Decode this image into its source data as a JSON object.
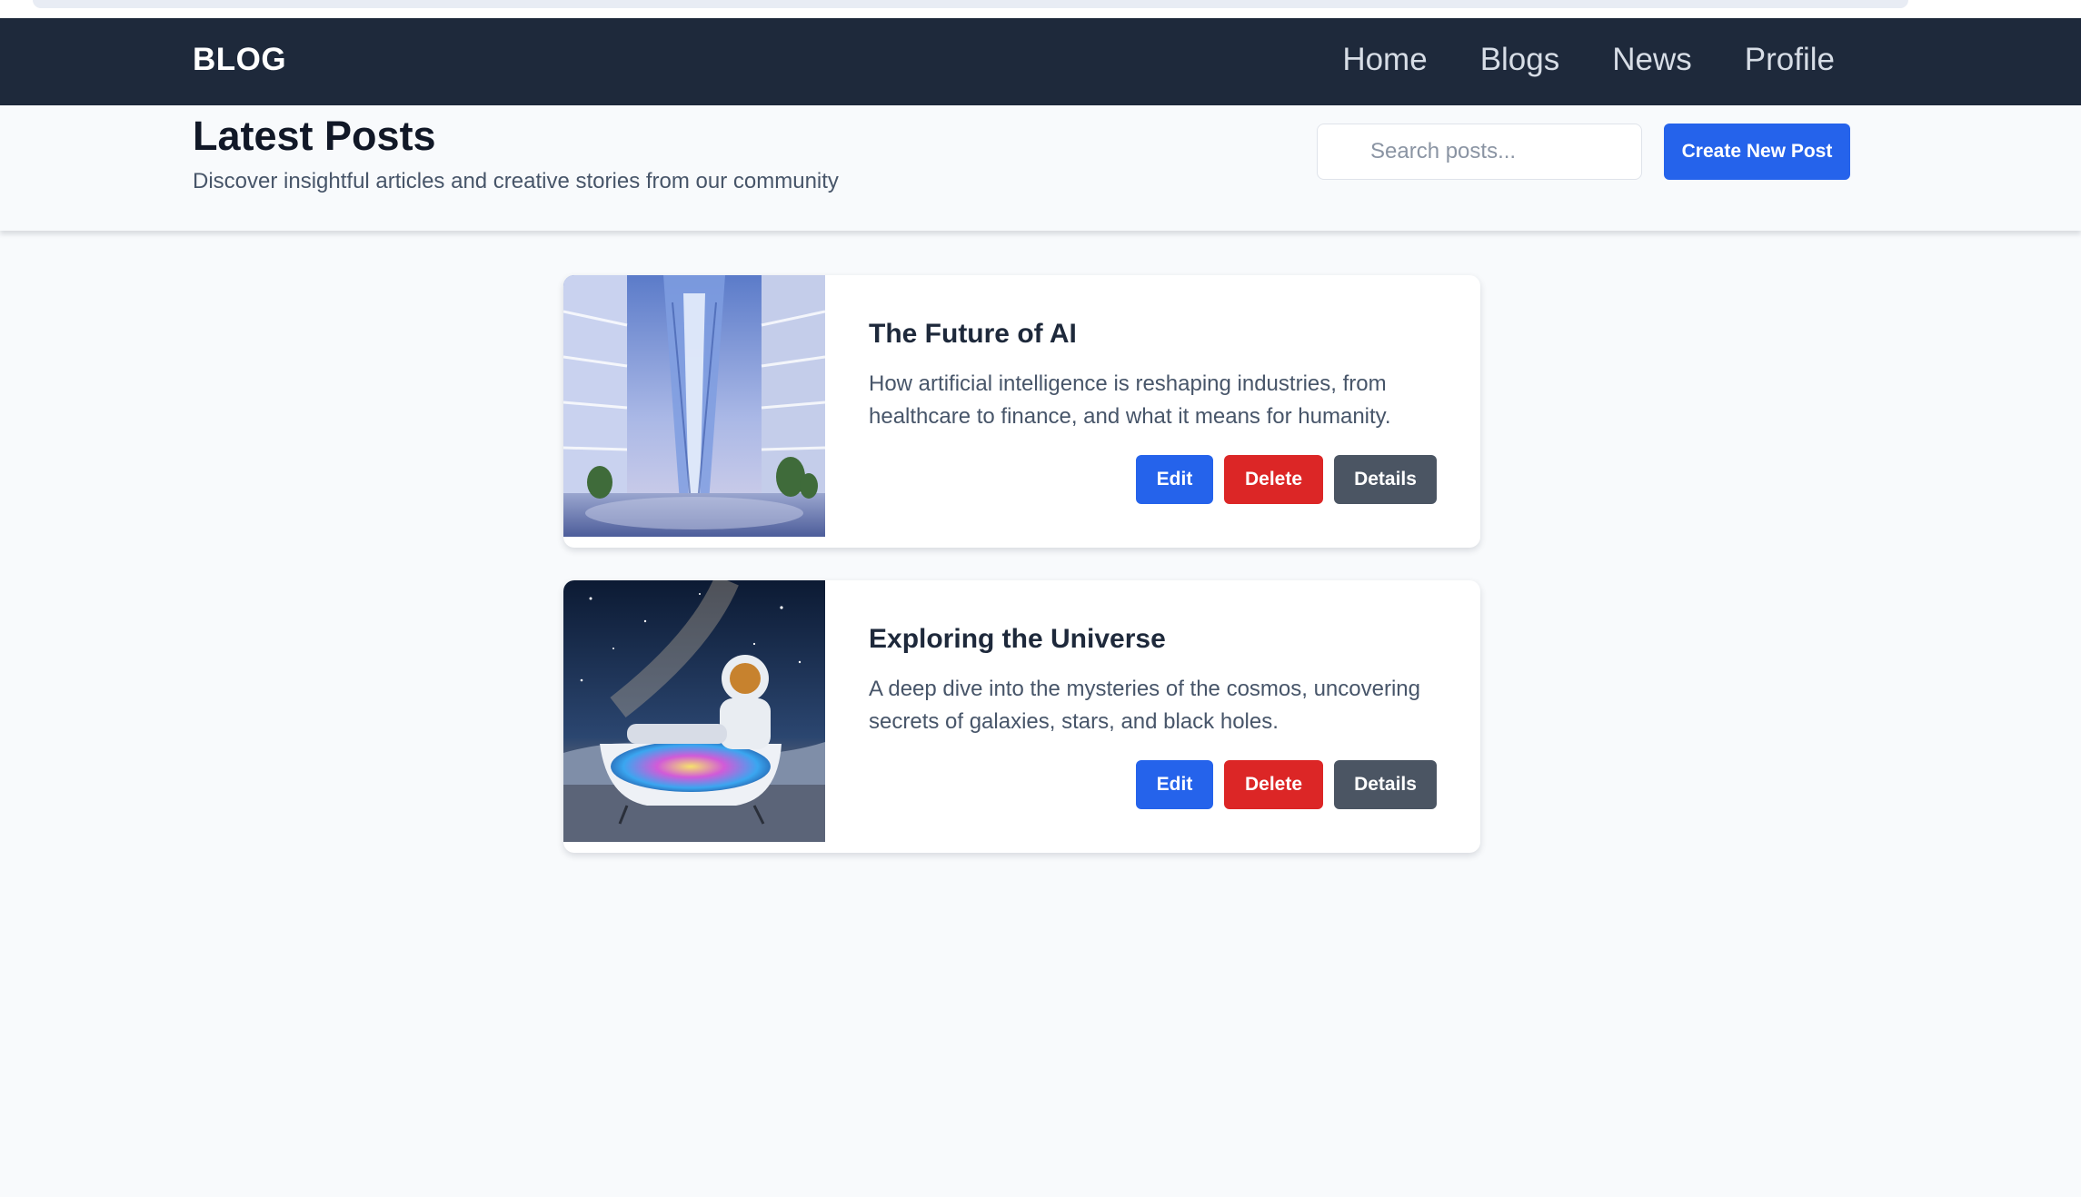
{
  "navbar": {
    "brand": "BLOG",
    "links": [
      "Home",
      "Blogs",
      "News",
      "Profile"
    ]
  },
  "header": {
    "title": "Latest Posts",
    "subtitle": "Discover insightful articles and creative stories from our community",
    "search_placeholder": "Search posts...",
    "create_button": "Create New Post"
  },
  "posts": [
    {
      "title": "The Future of AI",
      "excerpt": "How artificial intelligence is reshaping industries, from healthcare to finance, and what it means for humanity.",
      "image": "futuristic-atrium-image",
      "edit": "Edit",
      "delete": "Delete",
      "details": "Details"
    },
    {
      "title": "Exploring the Universe",
      "excerpt": "A deep dive into the mysteries of the cosmos, uncovering secrets of galaxies, stars, and black holes.",
      "image": "astronaut-bathtub-image",
      "edit": "Edit",
      "delete": "Delete",
      "details": "Details"
    }
  ],
  "colors": {
    "navbar_bg": "#1e293b",
    "primary": "#2563eb",
    "danger": "#dc2626",
    "secondary": "#4b5563",
    "page_bg": "#f8fafc"
  }
}
